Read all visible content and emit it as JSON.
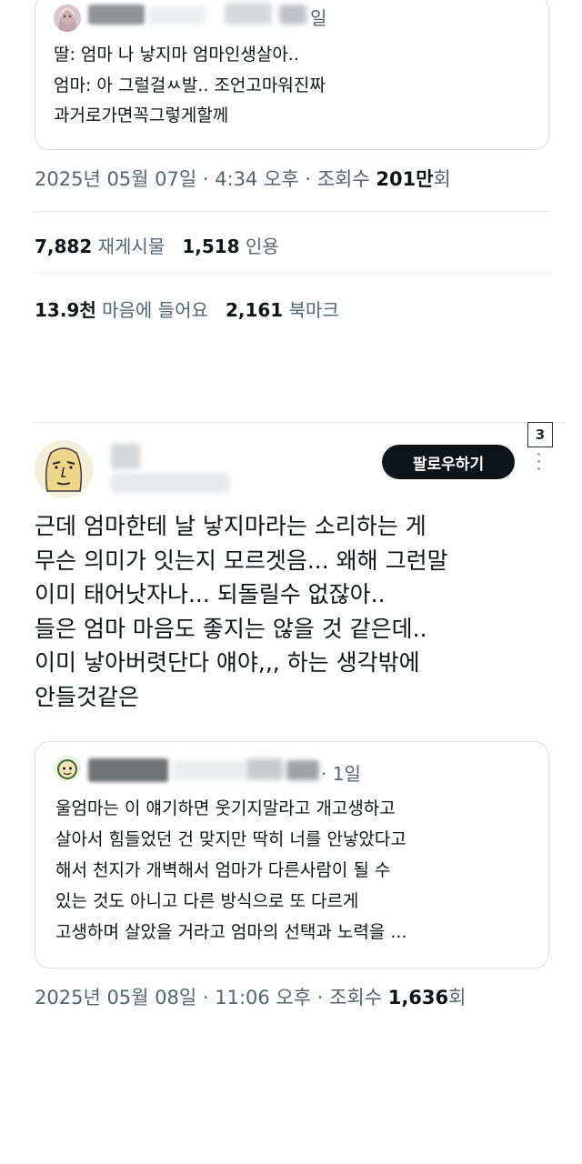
{
  "quoted_tweet": {
    "date": "일",
    "lines": [
      "딸: 엄마 나 낳지마 엄마인생살아..",
      "엄마: 아 그럴걸ㅆ발.. 조언고마워진짜",
      "과거로가면꼭그렇게할께"
    ]
  },
  "post_meta": {
    "timestamp": "2025년 05월 07일 · 4:34 오후 · 조회수 ",
    "views_number": "201만",
    "views_suffix": "회"
  },
  "engagement": {
    "retweets_count": "7,882",
    "retweets_label": "재게시물",
    "quotes_count": "1,518",
    "quotes_label": "인용",
    "likes_count": "13.9천",
    "likes_label": "마음에 들어요",
    "bookmarks_count": "2,161",
    "bookmarks_label": "북마크"
  },
  "reply": {
    "follow_button": "팔로우하기",
    "badge_number": "3",
    "lines": [
      "근데 엄마한테 날 낳지마라는 소리하는 게",
      "무슨 의미가 잇는지 모르겟음... 왜해 그런말",
      "이미 태어낫자나... 되돌릴수 없잖아..",
      "들은 엄마 마음도 좋지는 않을 것 같은데..",
      "이미 낳아버렷단다 얘야,,, 하는 생각밖에",
      "안들것같은"
    ]
  },
  "reply_quote": {
    "date": "· 1일",
    "lines": [
      "울엄마는 이 얘기하면 웃기지말라고 개고생하고",
      "살아서 힘들었던 건 맞지만 딱히 너를 안낳았다고",
      "해서 천지가 개벽해서 엄마가 다른사람이 될 수",
      "있는 것도 아니고 다른 방식으로 또 다르게",
      "고생하며 살았을 거라고 엄마의 선택과 노력을 ..."
    ]
  },
  "reply_meta": {
    "timestamp": "2025년 05월 08일 · 11:06 오후 · 조회수 ",
    "views_number": "1,636",
    "views_suffix": "회"
  },
  "colors": {
    "text_primary": "#0f1419",
    "text_secondary": "#536471",
    "border": "#d9dde0",
    "follow_button_bg": "#0f1419"
  },
  "icons": [
    "user-avatar-anime-girl",
    "user-avatar-cartoon-face",
    "user-avatar-small-cartoon",
    "more-options-vertical-icon"
  ]
}
